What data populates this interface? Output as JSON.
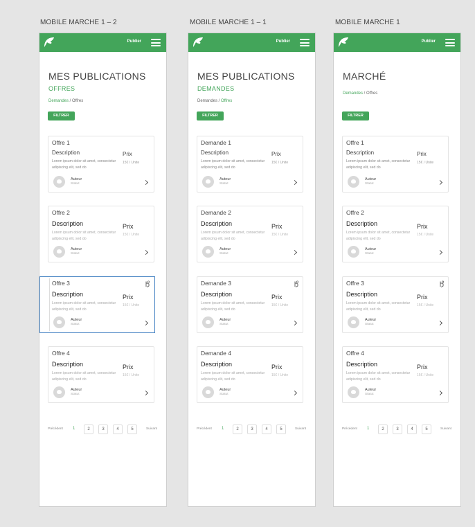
{
  "boards": [
    {
      "label": "MOBILE MARCHE 1 – 2",
      "publish": "Publier",
      "title": "MES PUBLICATIONS",
      "subtitle": "OFFRES",
      "breadcrumb": {
        "first": "Demandes",
        "sep": " / ",
        "second": "Offres"
      },
      "filter": "FILTRER",
      "cards": [
        {
          "title": "Offre 1",
          "desc": "Description",
          "lorem": "Lorem ipsum dolor sit amet, consectetur adipiscing elit, sed do",
          "price": "Prix",
          "unit": "15€ / Unite",
          "author": "Auteur",
          "status": "Statut"
        },
        {
          "title": "Offre 2",
          "desc": "Description",
          "lorem": "Lorem ipsum dolor sit amet, consectetur adipiscing elit, sed do",
          "price": "Prix",
          "unit": "15€ / Unite",
          "author": "Auteur",
          "status": "Statut"
        },
        {
          "title": "Offre 3",
          "desc": "Description",
          "lorem": "Lorem ipsum dolor sit amet, consectetur adipiscing elit, sed do",
          "price": "Prix",
          "unit": "15€ / Unite",
          "author": "Auteur",
          "status": "Statut"
        },
        {
          "title": "Offre 4",
          "desc": "Description",
          "lorem": "Lorem ipsum dolor sit amet, consectetur adipiscing elit, sed do",
          "price": "Prix",
          "unit": "15€ / Unite",
          "author": "Auteur",
          "status": "Statut"
        }
      ],
      "pager": {
        "prev": "Précédent",
        "active": "1",
        "pages": [
          "2",
          "3",
          "4",
          "5"
        ],
        "next": "Suivant"
      }
    },
    {
      "label": "MOBILE MARCHE 1 – 1",
      "publish": "Publier",
      "title": "MES PUBLICATIONS",
      "subtitle": "DEMANDES",
      "breadcrumb": {
        "first": "Demandes",
        "sep": " / ",
        "second": "Offres"
      },
      "filter": "FILTRER",
      "cards": [
        {
          "title": "Demande 1",
          "desc": "Description",
          "lorem": "Lorem ipsum dolor sit amet, consectetur adipiscing elit, sed do",
          "price": "Prix",
          "unit": "15€ / Unite",
          "author": "Auteur",
          "status": "Statut"
        },
        {
          "title": "Demande 2",
          "desc": "Description",
          "lorem": "Lorem ipsum dolor sit amet, consectetur adipiscing elit, sed do",
          "price": "Prix",
          "unit": "15€ / Unite",
          "author": "Auteur",
          "status": "Statut"
        },
        {
          "title": "Demande 3",
          "desc": "Description",
          "lorem": "Lorem ipsum dolor sit amet, consectetur adipiscing elit, sed do",
          "price": "Prix",
          "unit": "15€ / Unite",
          "author": "Auteur",
          "status": "Statut"
        },
        {
          "title": "Demande 4",
          "desc": "Description",
          "lorem": "Lorem ipsum dolor sit amet, consectetur adipiscing elit, sed do",
          "price": "Prix",
          "unit": "15€ / Unite",
          "author": "Auteur",
          "status": "Statut"
        }
      ],
      "pager": {
        "prev": "Précédent",
        "active": "1",
        "pages": [
          "2",
          "3",
          "4",
          "5"
        ],
        "next": "Suivant"
      }
    },
    {
      "label": "MOBILE MARCHE 1",
      "publish": "Publier",
      "title": "MARCHÉ",
      "subtitle": "",
      "breadcrumb": {
        "first": "Demandes",
        "sep": " / ",
        "second": "Offres"
      },
      "filter": "FILTRER",
      "cards": [
        {
          "title": "Offre 1",
          "desc": "Description",
          "lorem": "Lorem ipsum dolor sit amet, consectetur adipiscing elit, sed do",
          "price": "Prix",
          "unit": "15€ / Unite",
          "author": "Auteur",
          "status": "Statut"
        },
        {
          "title": "Offre 2",
          "desc": "Description",
          "lorem": "Lorem ipsum dolor sit amet, consectetur adipiscing elit, sed do",
          "price": "Prix",
          "unit": "15€ / Unite",
          "author": "Auteur",
          "status": "Statut"
        },
        {
          "title": "Offre 3",
          "desc": "Description",
          "lorem": "Lorem ipsum dolor sit amet, consectetur adipiscing elit, sed do",
          "price": "Prix",
          "unit": "15€ / Unite",
          "author": "Auteur",
          "status": "Statut"
        },
        {
          "title": "Offre 4",
          "desc": "Description",
          "lorem": "Lorem ipsum dolor sit amet, consectetur adipiscing elit, sed do",
          "price": "Prix",
          "unit": "15€ / Unite",
          "author": "Auteur",
          "status": "Statut"
        }
      ],
      "pager": {
        "prev": "Précédent",
        "active": "1",
        "pages": [
          "2",
          "3",
          "4",
          "5"
        ],
        "next": "Suivant"
      }
    }
  ],
  "colors": {
    "brand_green": "#43a55a",
    "selection_blue": "#4a86c5",
    "canvas": "#e5e5e5"
  },
  "icons": {
    "logo": "leaf-logo-icon",
    "menu": "hamburger-menu-icon",
    "chevron": "chevron-right-icon",
    "touch": "touch-hand-icon",
    "avatar": "user-avatar-icon"
  }
}
